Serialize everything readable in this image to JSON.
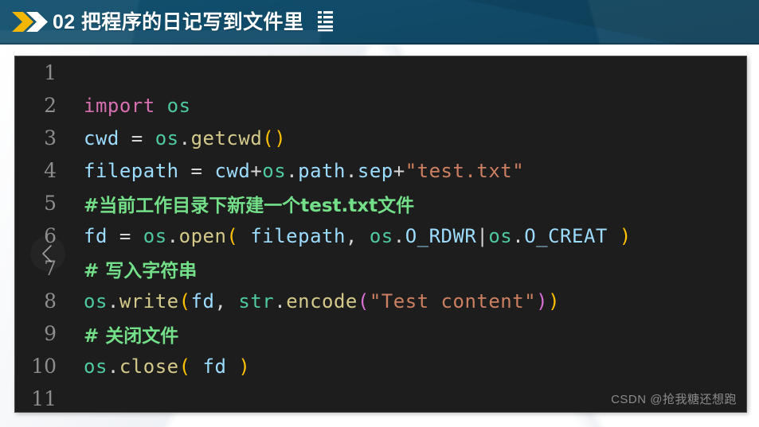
{
  "header": {
    "title": "02 把程序的日记写到文件里",
    "background_color": "#114966",
    "chevron_primary_color": "#f2b705",
    "chevron_secondary_color": "#ffffff",
    "title_color": "#ffffff",
    "icons": {
      "chevron_pair": "double-chevron-right-icon",
      "list_glyph": "list-lines-icon"
    }
  },
  "code_block": {
    "background_color": "#1d1d1d",
    "line_number_color": "#8d8d8d",
    "language": "python",
    "line_count": 11,
    "lines": [
      {
        "number": "1",
        "tokens": []
      },
      {
        "number": "2",
        "tokens": [
          {
            "text": "import",
            "cls": "t-kw"
          },
          {
            "text": " ",
            "cls": "t-plain"
          },
          {
            "text": "os",
            "cls": "t-mod"
          }
        ]
      },
      {
        "number": "3",
        "tokens": [
          {
            "text": "cwd",
            "cls": "t-var"
          },
          {
            "text": " = ",
            "cls": "t-op"
          },
          {
            "text": "os",
            "cls": "t-mod"
          },
          {
            "text": ".",
            "cls": "t-op"
          },
          {
            "text": "getcwd",
            "cls": "t-fn"
          },
          {
            "text": "()",
            "cls": "t-par"
          }
        ]
      },
      {
        "number": "4",
        "tokens": [
          {
            "text": "filepath",
            "cls": "t-var"
          },
          {
            "text": " = ",
            "cls": "t-op"
          },
          {
            "text": "cwd",
            "cls": "t-var"
          },
          {
            "text": "+",
            "cls": "t-op"
          },
          {
            "text": "os",
            "cls": "t-mod"
          },
          {
            "text": ".",
            "cls": "t-op"
          },
          {
            "text": "path",
            "cls": "t-var"
          },
          {
            "text": ".",
            "cls": "t-op"
          },
          {
            "text": "sep",
            "cls": "t-var"
          },
          {
            "text": "+",
            "cls": "t-op"
          },
          {
            "text": "\"test.txt\"",
            "cls": "t-str"
          }
        ]
      },
      {
        "number": "5",
        "comment": true,
        "tokens": [
          {
            "text": "#当前工作目录下新建一个test.txt文件",
            "cls": "t-cmt"
          }
        ]
      },
      {
        "number": "6",
        "tokens": [
          {
            "text": "fd",
            "cls": "t-var"
          },
          {
            "text": " = ",
            "cls": "t-op"
          },
          {
            "text": "os",
            "cls": "t-mod"
          },
          {
            "text": ".",
            "cls": "t-op"
          },
          {
            "text": "open",
            "cls": "t-fn"
          },
          {
            "text": "(",
            "cls": "t-par"
          },
          {
            "text": " ",
            "cls": "t-plain"
          },
          {
            "text": "filepath",
            "cls": "t-var"
          },
          {
            "text": ", ",
            "cls": "t-op"
          },
          {
            "text": "os",
            "cls": "t-mod"
          },
          {
            "text": ".",
            "cls": "t-op"
          },
          {
            "text": "O_RDWR",
            "cls": "t-attr"
          },
          {
            "text": "|",
            "cls": "t-op"
          },
          {
            "text": "os",
            "cls": "t-mod"
          },
          {
            "text": ".",
            "cls": "t-op"
          },
          {
            "text": "O_CREAT",
            "cls": "t-attr"
          },
          {
            "text": " ",
            "cls": "t-plain"
          },
          {
            "text": ")",
            "cls": "t-par"
          }
        ]
      },
      {
        "number": "7",
        "comment": true,
        "tokens": [
          {
            "text": "# 写入字符串",
            "cls": "t-cmt"
          }
        ]
      },
      {
        "number": "8",
        "tokens": [
          {
            "text": "os",
            "cls": "t-mod"
          },
          {
            "text": ".",
            "cls": "t-op"
          },
          {
            "text": "write",
            "cls": "t-fn"
          },
          {
            "text": "(",
            "cls": "t-par"
          },
          {
            "text": "fd",
            "cls": "t-var"
          },
          {
            "text": ", ",
            "cls": "t-op"
          },
          {
            "text": "str",
            "cls": "t-mod"
          },
          {
            "text": ".",
            "cls": "t-op"
          },
          {
            "text": "encode",
            "cls": "t-fn"
          },
          {
            "text": "(",
            "cls": "t-par2"
          },
          {
            "text": "\"Test content\"",
            "cls": "t-str"
          },
          {
            "text": ")",
            "cls": "t-par2"
          },
          {
            "text": ")",
            "cls": "t-par"
          }
        ]
      },
      {
        "number": "9",
        "comment": true,
        "tokens": [
          {
            "text": "# 关闭文件",
            "cls": "t-cmt"
          }
        ]
      },
      {
        "number": "10",
        "tokens": [
          {
            "text": "os",
            "cls": "t-mod"
          },
          {
            "text": ".",
            "cls": "t-op"
          },
          {
            "text": "close",
            "cls": "t-fn"
          },
          {
            "text": "(",
            "cls": "t-par"
          },
          {
            "text": " ",
            "cls": "t-plain"
          },
          {
            "text": "fd",
            "cls": "t-var"
          },
          {
            "text": " ",
            "cls": "t-plain"
          },
          {
            "text": ")",
            "cls": "t-par"
          }
        ]
      },
      {
        "number": "11",
        "tokens": []
      }
    ]
  },
  "nav": {
    "previous_icon": "chevron-left-icon"
  },
  "watermark": {
    "text": "CSDN @抢我糖还想跑"
  }
}
